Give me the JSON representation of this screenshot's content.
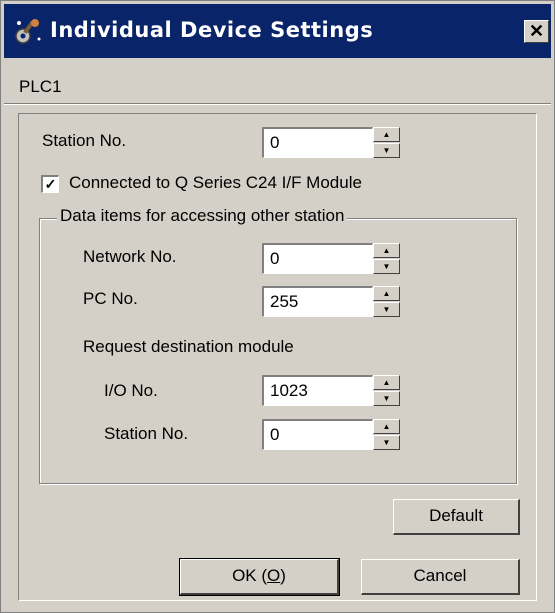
{
  "window": {
    "title": "Individual Device Settings",
    "close_glyph": "✕"
  },
  "device_name": "PLC1",
  "station_no": {
    "label": "Station No.",
    "value": "0"
  },
  "q_series": {
    "label": "Connected to Q Series C24 I/F Module",
    "checked": true,
    "check_glyph": "✓"
  },
  "group": {
    "title": "Data items for accessing other station",
    "network_no": {
      "label": "Network No.",
      "value": "0"
    },
    "pc_no": {
      "label": "PC No.",
      "value": "255"
    },
    "request_label": "Request destination module",
    "io_no": {
      "label": "I/O No.",
      "value": "1023"
    },
    "station_no": {
      "label": "Station No.",
      "value": "0"
    }
  },
  "spin_glyphs": {
    "up": "▲",
    "down": "▼"
  },
  "buttons": {
    "default": "Default",
    "ok_prefix": "OK (",
    "ok_key": "O",
    "ok_suffix": ")",
    "cancel": "Cancel"
  },
  "icons": {
    "title": "wrench-gear-icon",
    "close": "close-icon"
  },
  "colors": {
    "titlebar": "#0a246a",
    "face": "#d4d0c8"
  }
}
